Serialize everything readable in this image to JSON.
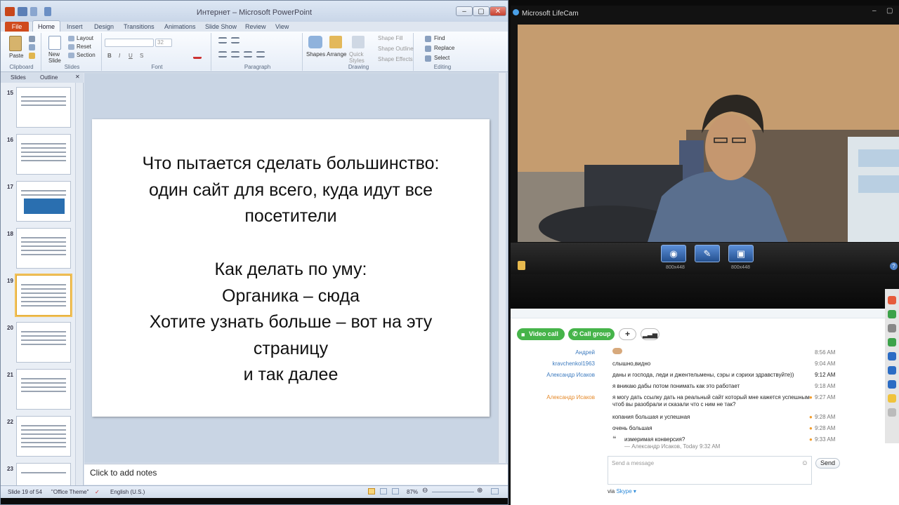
{
  "powerpoint": {
    "title": "Интернет – Microsoft PowerPoint",
    "window_buttons": [
      "–",
      "▢",
      "✕"
    ],
    "file_tab": "File",
    "tabs": [
      "Home",
      "Insert",
      "Design",
      "Transitions",
      "Animations",
      "Slide Show",
      "Review",
      "View"
    ],
    "ribbon": {
      "paste": "Paste",
      "new_slide": "New Slide",
      "layout": "Layout",
      "reset": "Reset",
      "section": "Section",
      "font_size": "32",
      "shapes": "Shapes",
      "arrange": "Arrange",
      "quick_styles": "Quick Styles",
      "shape_fill": "Shape Fill",
      "shape_outline": "Shape Outline",
      "shape_effects": "Shape Effects",
      "find": "Find",
      "replace": "Replace",
      "select": "Select",
      "groups": [
        "Clipboard",
        "Slides",
        "Font",
        "Paragraph",
        "Drawing",
        "Editing"
      ]
    },
    "panel_tabs": [
      "Slides",
      "Outline"
    ],
    "thumbnails": [
      "15",
      "16",
      "17",
      "18",
      "19",
      "20",
      "21",
      "22",
      "23"
    ],
    "selected_slide": "19",
    "slide_text_block1": [
      "Что пытается сделать большинство:",
      "один сайт для всего, куда идут все",
      "посетители"
    ],
    "slide_text_block2": [
      "Как делать по уму:",
      "Органика – сюда",
      "Хотите узнать больше – вот на эту",
      "страницу",
      "и так далее"
    ],
    "notes_placeholder": "Click to add notes",
    "status": {
      "slide": "Slide 19 of 54",
      "theme": "\"Office Theme\"",
      "language": "English (U.S.)",
      "zoom": "87%"
    }
  },
  "lifecam": {
    "title": "Microsoft LifeCam",
    "labels": [
      "800x448",
      "800x448"
    ]
  },
  "skype": {
    "video_call": "Video call",
    "call_group": "Call group",
    "messages": [
      {
        "who": "Андрей",
        "text": "",
        "time": "8:56 AM",
        "who_color": "#3d7bbf"
      },
      {
        "who": "kravchenkol1963",
        "text": "слышно,видно",
        "time": "9:04 AM",
        "who_color": "#3d7bbf"
      },
      {
        "who": "Александр Исаков",
        "text": "даны и господа, леди и джентельмены, сэры и сэрихи здравствуйте))",
        "time": "9:12 AM",
        "who_color": "#3d7bbf"
      },
      {
        "who": "",
        "text": "я вникаю дабы потом понимать как это работает",
        "time": "9:18 AM",
        "who_color": "#3d7bbf"
      },
      {
        "who": "Александр Исаков",
        "text": "я могу дать ссылку дать на реальный сайт который мне кажется успешным",
        "text2": "чтоб вы разобрали и сказали что с ним не так?",
        "time": "9:27 AM",
        "who_color": "#e58a2b"
      },
      {
        "who": "",
        "text": "копания большая и успешная",
        "time": "9:28 AM",
        "who_color": "#e58a2b"
      },
      {
        "who": "",
        "text": "очень большая",
        "time": "9:28 AM",
        "who_color": "#e58a2b"
      },
      {
        "who": "",
        "text": "измеримая конверсия?",
        "text2": "— Александр Исаков, Today 9:32 AM",
        "time": "9:33 AM",
        "who_color": "#e58a2b"
      }
    ],
    "input_placeholder": "Send a message",
    "send": "Send",
    "via": "via",
    "via_link": "Skype ▾"
  }
}
